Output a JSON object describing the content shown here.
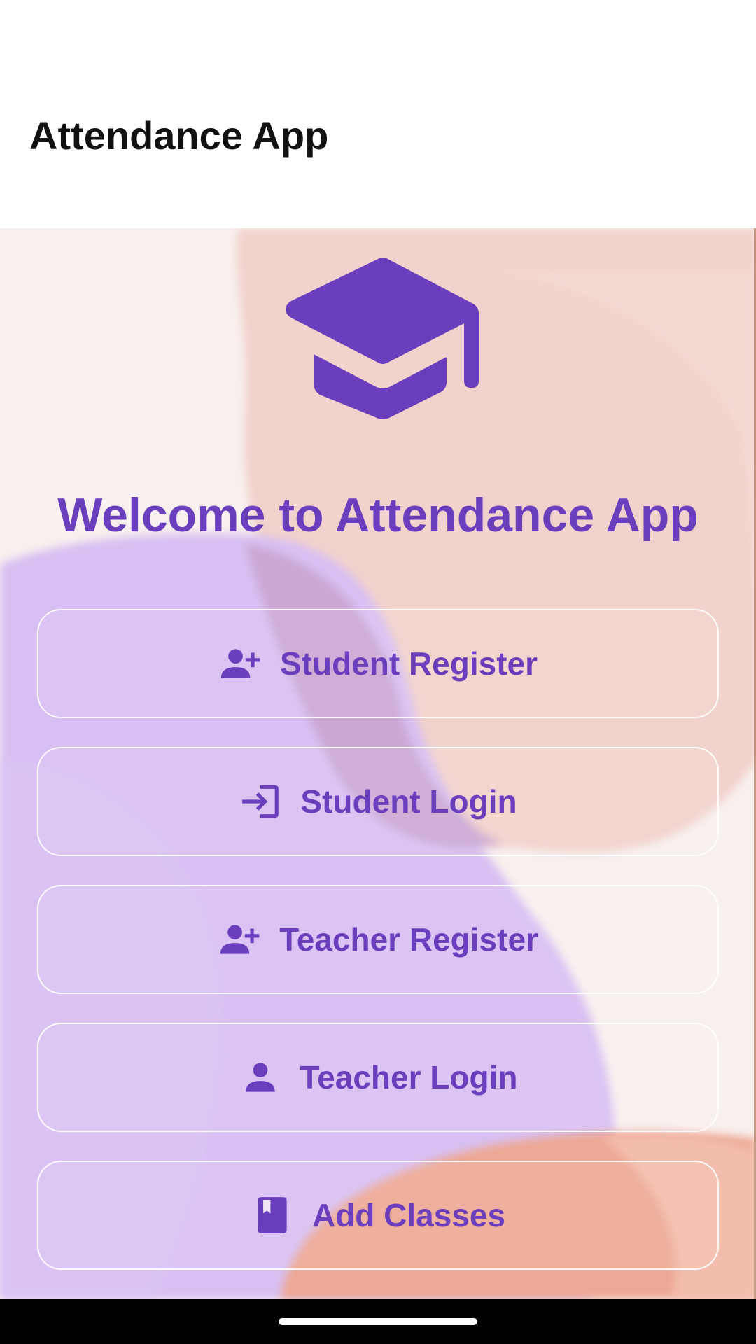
{
  "app_bar": {
    "title": "Attendance App"
  },
  "hero": {
    "icon": "graduation-cap-icon",
    "welcome_text": "Welcome to Attendance App"
  },
  "colors": {
    "accent": "#6b3ebd",
    "button_border": "#ffffff",
    "background_peach": "#f4d6d0",
    "background_lavender": "#dcc0f4",
    "background_salmon": "#eaa690"
  },
  "buttons": [
    {
      "label": "Student Register",
      "icon": "person-add-icon"
    },
    {
      "label": "Student Login",
      "icon": "login-icon"
    },
    {
      "label": "Teacher Register",
      "icon": "person-add-icon"
    },
    {
      "label": "Teacher Login",
      "icon": "person-icon"
    },
    {
      "label": "Add Classes",
      "icon": "book-icon"
    }
  ]
}
